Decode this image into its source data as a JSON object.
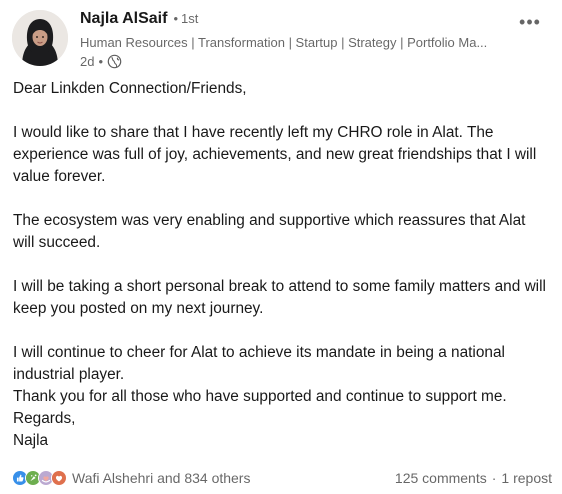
{
  "author": {
    "name": "Najla AlSaif",
    "degree": "1st",
    "headline": "Human Resources | Transformation | Startup | Strategy | Portfolio Ma...",
    "time": "2d",
    "visibility_icon": "globe-icon"
  },
  "post": {
    "greeting": "Dear Linkden Connection/Friends,",
    "para1": "I would like to share that I have recently left my CHRO role in Alat. The experience was full of joy, achievements, and new great friendships that I will value forever.",
    "para2": "The ecosystem was very enabling and supportive which reassures that Alat will succeed.",
    "para3": "I will be taking a short personal break to attend to some family matters and will keep you posted on my next journey.",
    "para4_line1": "I will continue to cheer for Alat to achieve its mandate in being a national industrial player.",
    "para4_line2": "Thank you for all those who have supported and continue to support me.",
    "para4_line3": "Regards,",
    "signature": "Najla"
  },
  "social": {
    "reaction_icons": [
      "like-icon",
      "celebrate-icon",
      "support-icon",
      "love-icon"
    ],
    "reactions_label": "Wafi Alshehri and 834 others",
    "comments": "125 comments",
    "reposts": "1 repost"
  },
  "colors": {
    "like": "#378fe9",
    "celebrate": "#6dae4f",
    "support": "#bba9d1",
    "love": "#df704d"
  }
}
